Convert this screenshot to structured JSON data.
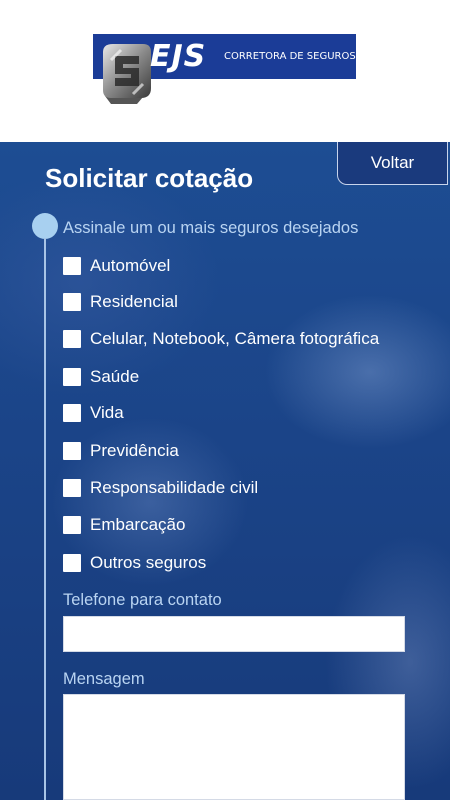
{
  "header": {
    "logo_text": "EJS",
    "logo_subtitle": "CORRETORA DE SEGUROS"
  },
  "form": {
    "back_label": "Voltar",
    "title": "Solicitar cotação",
    "insurance_prompt": "Assinale um ou mais seguros desejados",
    "options": [
      {
        "label": "Automóvel",
        "checked": false
      },
      {
        "label": "Residencial",
        "checked": false
      },
      {
        "label": "Celular, Notebook, Câmera fotográfica",
        "checked": false
      },
      {
        "label": "Saúde",
        "checked": false
      },
      {
        "label": "Vida",
        "checked": false
      },
      {
        "label": "Previdência",
        "checked": false
      },
      {
        "label": "Responsabilidade civil",
        "checked": false
      },
      {
        "label": "Embarcação",
        "checked": false
      },
      {
        "label": "Outros seguros",
        "checked": false
      }
    ],
    "phone_label": "Telefone para contato",
    "phone_value": "",
    "message_label": "Mensagem",
    "message_value": ""
  },
  "colors": {
    "brand_blue": "#1b3c97",
    "panel_blue": "#1b4488",
    "label_blue": "#b9d4f2",
    "timeline_dot": "#a8d0f0"
  }
}
